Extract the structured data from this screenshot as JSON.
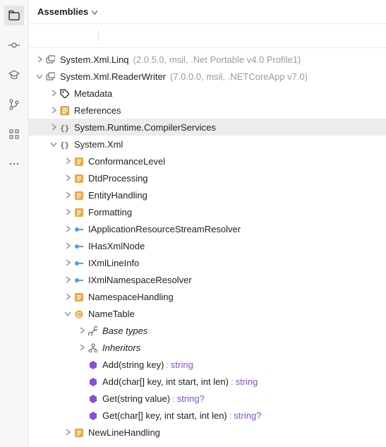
{
  "header": {
    "title": "Assemblies"
  },
  "assemblies": [
    {
      "name": "System.Xml.Linq",
      "meta": "(2.0.5.0, msil, .Net Portable v4.0 Profile1)"
    },
    {
      "name": "System.Xml.ReaderWriter",
      "meta": "(7.0.0.0, msil, .NETCoreApp v7.0)"
    }
  ],
  "metadata": {
    "label": "Metadata"
  },
  "references": {
    "label": "References"
  },
  "namespaces": {
    "compiler": "System.Runtime.CompilerServices",
    "xml": "System.Xml"
  },
  "xmlMembers": [
    {
      "name": "ConformanceLevel",
      "kind": "enum"
    },
    {
      "name": "DtdProcessing",
      "kind": "enum"
    },
    {
      "name": "EntityHandling",
      "kind": "enum"
    },
    {
      "name": "Formatting",
      "kind": "enum"
    },
    {
      "name": "IApplicationResourceStreamResolver",
      "kind": "interface"
    },
    {
      "name": "IHasXmlNode",
      "kind": "interface"
    },
    {
      "name": "IXmlLineInfo",
      "kind": "interface"
    },
    {
      "name": "IXmlNamespaceResolver",
      "kind": "interface"
    },
    {
      "name": "NamespaceHandling",
      "kind": "enum"
    }
  ],
  "nameTable": {
    "label": "NameTable",
    "baseTypes": "Base types",
    "inheritors": "Inheritors",
    "methods": [
      {
        "sig": "Add(string key)",
        "ret": "string"
      },
      {
        "sig": "Add(char[] key, int start, int len)",
        "ret": "string"
      },
      {
        "sig": "Get(string value)",
        "ret": "string?"
      },
      {
        "sig": "Get(char[] key, int start, int len)",
        "ret": "string?"
      }
    ]
  },
  "newLineHandling": {
    "label": "NewLineHandling"
  }
}
